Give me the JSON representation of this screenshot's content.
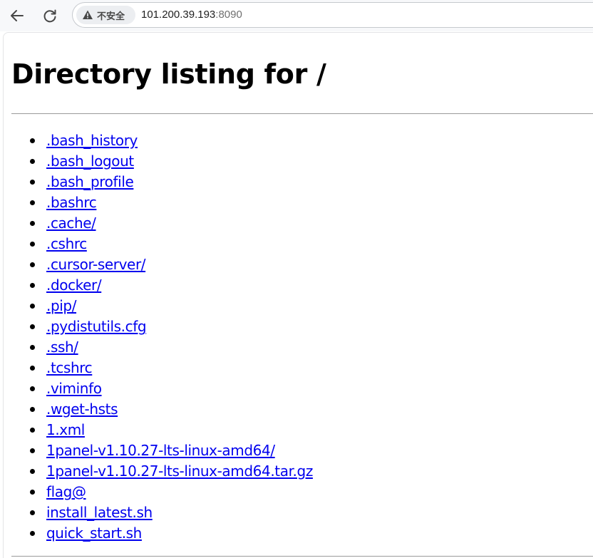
{
  "browser": {
    "back_icon": "arrow-left-icon",
    "reload_icon": "reload-icon",
    "security_icon": "warning-triangle-icon",
    "security_label": "不安全",
    "url_host": "101.200.39.193",
    "url_port": ":8090"
  },
  "page": {
    "title": "Directory listing for /",
    "entries": [
      ".bash_history",
      ".bash_logout",
      ".bash_profile",
      ".bashrc",
      ".cache/",
      ".cshrc",
      ".cursor-server/",
      ".docker/",
      ".pip/",
      ".pydistutils.cfg",
      ".ssh/",
      ".tcshrc",
      ".viminfo",
      ".wget-hsts",
      "1.xml",
      "1panel-v1.10.27-lts-linux-amd64/",
      "1panel-v1.10.27-lts-linux-amd64.tar.gz",
      "flag@",
      "install_latest.sh",
      "quick_start.sh"
    ]
  },
  "colors": {
    "link": "#0000ee",
    "toolbar_bg": "#f7f8fa"
  }
}
